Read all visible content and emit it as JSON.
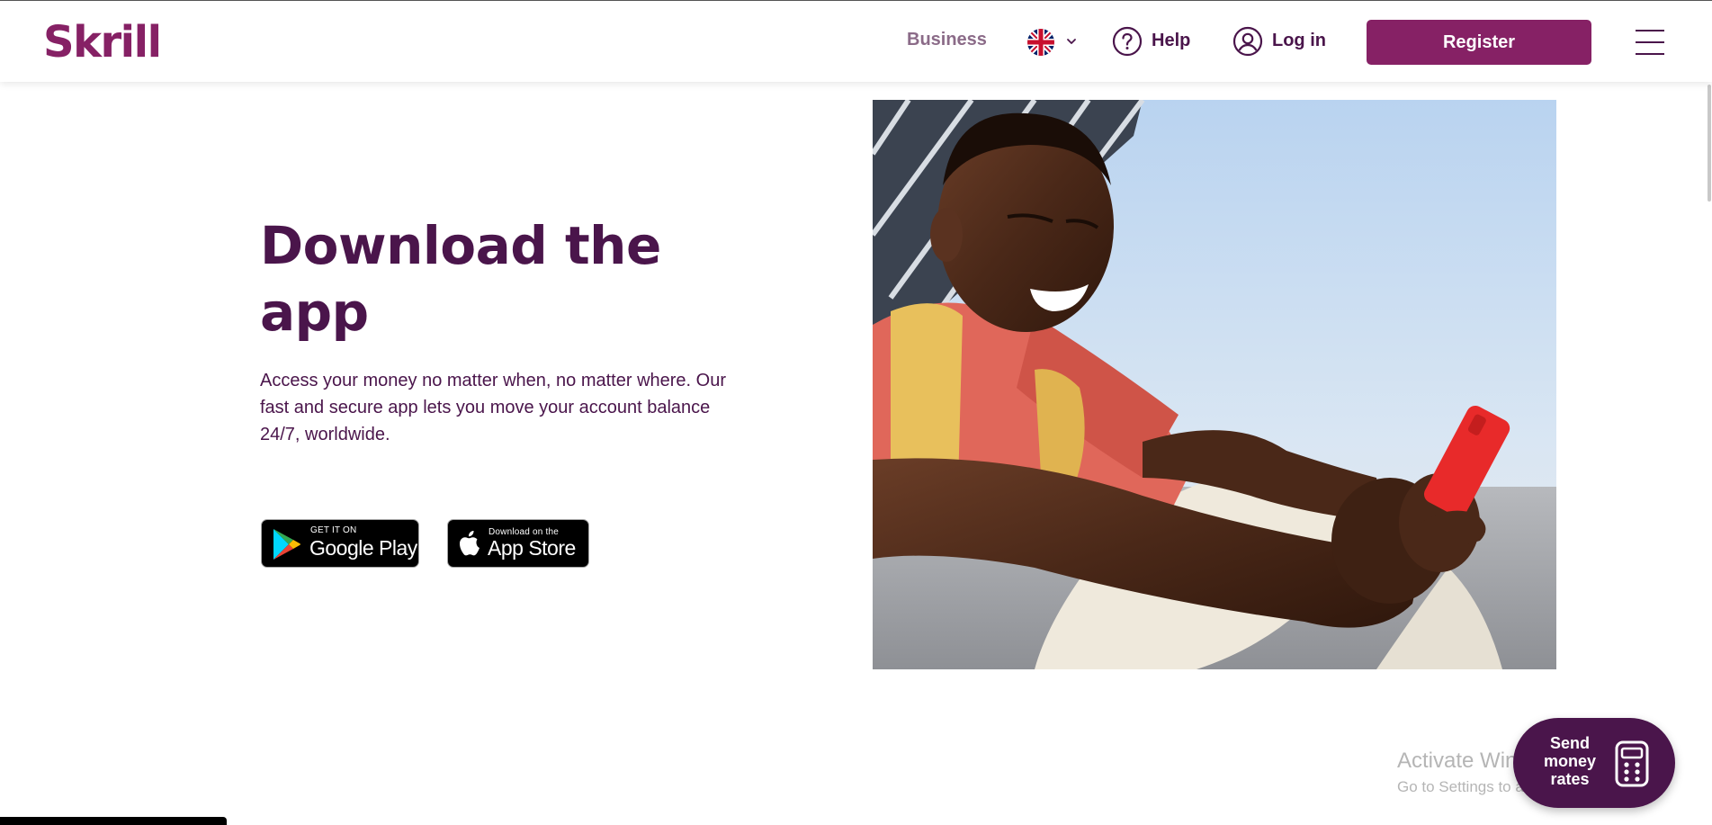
{
  "header": {
    "logo": "Skrill",
    "business_label": "Business",
    "help_label": "Help",
    "login_label": "Log in",
    "register_label": "Register"
  },
  "hero": {
    "title": "Download the app",
    "description": "Access your money no matter when, no matter where. Our fast and secure app lets you move your account balance 24/7, worldwide.",
    "google_play": {
      "small": "GET IT ON",
      "big": "Google Play"
    },
    "app_store": {
      "small": "Download on the",
      "big": "App Store"
    }
  },
  "floating": {
    "send_money_rates": "Send money rates"
  },
  "watermark": {
    "title": "Activate Windows",
    "subtitle": "Go to Settings to activate Windows."
  },
  "colors": {
    "brand": "#862165",
    "text_dark": "#4a154b",
    "business_text": "#8b6b88"
  }
}
